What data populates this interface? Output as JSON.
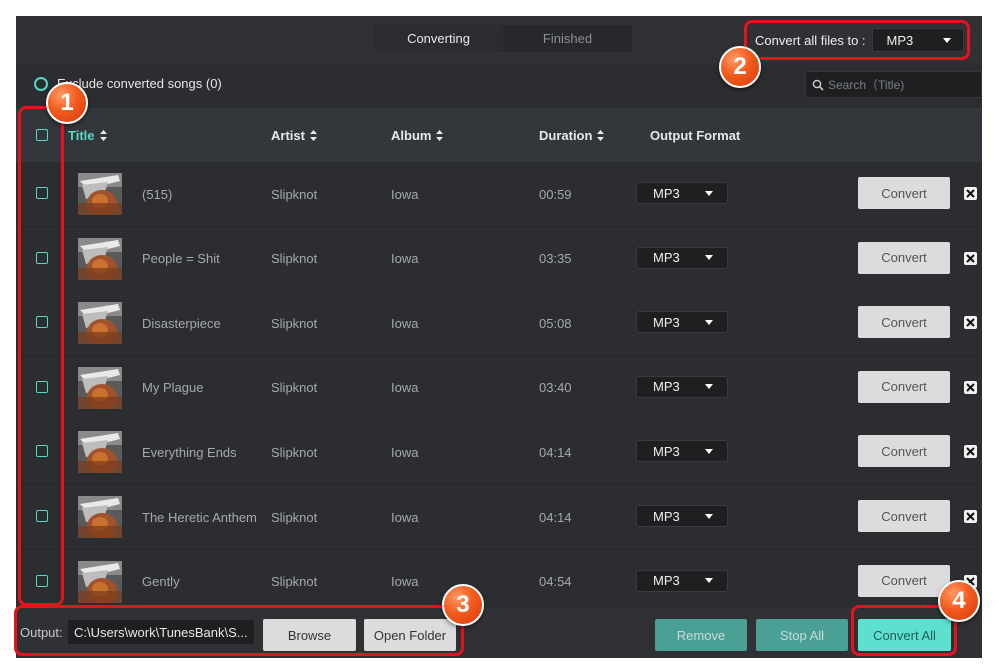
{
  "tabs": [
    {
      "label": "Converting"
    },
    {
      "label": "Finished"
    }
  ],
  "convert_all": {
    "label": "Convert all files to :",
    "value": "MP3"
  },
  "exclude": {
    "label": "Exclude converted songs (0)"
  },
  "search": {
    "placeholder": "Search（Title)"
  },
  "columns": {
    "title": "Title",
    "artist": "Artist",
    "album": "Album",
    "duration": "Duration",
    "output_format": "Output Format"
  },
  "rows": [
    {
      "title": "(515)",
      "artist": "Slipknot",
      "album": "Iowa",
      "duration": "00:59",
      "format": "MP3",
      "action": "Convert"
    },
    {
      "title": "People = Shit",
      "artist": "Slipknot",
      "album": "Iowa",
      "duration": "03:35",
      "format": "MP3",
      "action": "Convert"
    },
    {
      "title": "Disasterpiece",
      "artist": "Slipknot",
      "album": "Iowa",
      "duration": "05:08",
      "format": "MP3",
      "action": "Convert"
    },
    {
      "title": "My Plague",
      "artist": "Slipknot",
      "album": "Iowa",
      "duration": "03:40",
      "format": "MP3",
      "action": "Convert"
    },
    {
      "title": "Everything Ends",
      "artist": "Slipknot",
      "album": "Iowa",
      "duration": "04:14",
      "format": "MP3",
      "action": "Convert"
    },
    {
      "title": "The Heretic Anthem",
      "artist": "Slipknot",
      "album": "Iowa",
      "duration": "04:14",
      "format": "MP3",
      "action": "Convert"
    },
    {
      "title": "Gently",
      "artist": "Slipknot",
      "album": "Iowa",
      "duration": "04:54",
      "format": "MP3",
      "action": "Convert"
    }
  ],
  "bottom": {
    "output_label": "Output:",
    "output_path": "C:\\Users\\work\\TunesBank\\S...",
    "browse": "Browse",
    "open_folder": "Open Folder",
    "remove": "Remove",
    "stop_all": "Stop All",
    "convert_all": "Convert All"
  },
  "badges": [
    "1",
    "2",
    "3",
    "4"
  ],
  "colors": {
    "accent": "#58d6c6",
    "highlight": "#e8121c",
    "badge": "#f25a1d",
    "background": "#2b2d30"
  }
}
